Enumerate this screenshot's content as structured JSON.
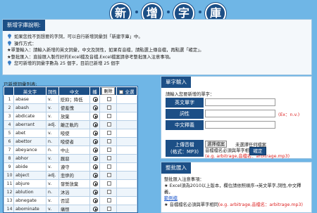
{
  "title": {
    "chars": [
      "新",
      "增",
      "字",
      "庫"
    ]
  },
  "info": {
    "heading": "新增字庫說明:",
    "line1": "如果您找不到想要的字詞，可以自行新增詞彙到「新建字庫」中。",
    "line2": "操作方式：",
    "line3": "★單筆輸入：請輸入新增的英文詞彙，中文及詞性，如果有音檔，請點選上傳音檔，再點選「確定」。",
    "line4": "★整批匯入：直接匯入製作好的Excel檔及音檔,Excel檔案請參考整批匯入注意事項。",
    "line5": "您可新增的詞彙字數為 25 個字，目前已新增 25 個字"
  },
  "list": {
    "label": "已新增詞彙列表:",
    "headers": {
      "num": "",
      "en": "英文字",
      "pos": "詞性",
      "zh": "中文",
      "audio": "播",
      "delete": "刪除",
      "select_all": "全選"
    },
    "rows": [
      {
        "num": "1",
        "en": "abase",
        "pos": "v.",
        "zh": "貶抑；降低"
      },
      {
        "num": "2",
        "en": "abash",
        "pos": "v.",
        "zh": "使羞愧"
      },
      {
        "num": "3",
        "en": "abdicate",
        "pos": "v.",
        "zh": "放棄"
      },
      {
        "num": "4",
        "en": "aberrant",
        "pos": "adj.",
        "zh": "離正軌的"
      },
      {
        "num": "5",
        "en": "abet",
        "pos": "v.",
        "zh": "唆使"
      },
      {
        "num": "6",
        "en": "abettor",
        "pos": "n.",
        "zh": "唆使者"
      },
      {
        "num": "7",
        "en": "abeyance",
        "pos": "n.",
        "zh": "中止"
      },
      {
        "num": "8",
        "en": "abhor",
        "pos": "v.",
        "zh": "厭惡"
      },
      {
        "num": "9",
        "en": "abide",
        "pos": "v.",
        "zh": "遵守"
      },
      {
        "num": "10",
        "en": "abject",
        "pos": "adj.",
        "zh": "悲慘的"
      },
      {
        "num": "11",
        "en": "abjure",
        "pos": "v.",
        "zh": "發誓放棄"
      },
      {
        "num": "12",
        "en": "ablution",
        "pos": "n.",
        "zh": "沐浴"
      },
      {
        "num": "13",
        "en": "abnegate",
        "pos": "v.",
        "zh": "否認"
      },
      {
        "num": "14",
        "en": "abominate",
        "pos": "v.",
        "zh": "痛恨"
      }
    ]
  },
  "add_word": {
    "heading": "單字輸入",
    "prompt": "請輸入您要新增的單字：",
    "en_label": "英文單字",
    "pos_label": "詞性",
    "pos_hint": "(Ex：n.v.)",
    "zh_label": "中文釋義",
    "upload_label_1": "上傳音檔",
    "upload_label_2": "(格式：MP3)",
    "file_button": "選擇檔案",
    "file_status": "未選擇任何檔案",
    "file_note_1": "音檔檔名必須與單字相同",
    "file_note_2": "(e.g. arbitrage,音檔名：arbitrage.mp3)",
    "confirm": "確定"
  },
  "bulk": {
    "heading": "整批匯入",
    "line1": "整批匯入注意事項：",
    "line2": "★ Excel須為2010以上版本，欄位請依照順序→英文單字,詞性,中文釋義，",
    "line2_link": "範例檔",
    "line3_prefix": "★ 音檔檔名必須與單字相同",
    "line3_red": "(e.g. arbitrage,音檔名：arbitrage.mp3)"
  },
  "colors": {
    "accent": "#1c4f86",
    "background": "#6fb6e6",
    "warning": "#dd2222"
  }
}
